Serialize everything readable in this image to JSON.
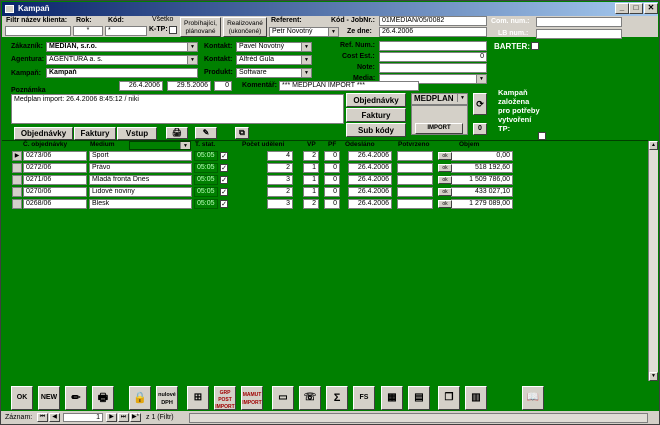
{
  "window": {
    "title": "Kampaň",
    "min": "_",
    "max": "□",
    "close": "✕"
  },
  "header": {
    "filter_label": "Filtr název klienta:",
    "rok_label": "Rok:",
    "kod_label": "Kód:",
    "filter_value": "",
    "rok_value": "*",
    "kod_value": "*",
    "vsetko_label": "Všetko",
    "ktp_label": "K-TP:",
    "btn_probihajici": "Probíhající, plánované",
    "btn_realizovane": "Realizované (ukončené)",
    "referent_label": "Referent:",
    "referent_value": "Petr Novotný",
    "kod_jobn_label": "Kód - JobNr.:",
    "kod_jobn_value": "01MEDIAN/05/0082",
    "ze_dne_label": "Ze dne:",
    "ze_dne_value": "26.4.2006",
    "com_num_label": "Com. num.:",
    "lb_num_label": "LB num.:",
    "barter_label": "BARTER:"
  },
  "form": {
    "zakaznik_label": "Zákazník:",
    "zakaznik_value": "MEDIAN, s.r.o.",
    "agentura_label": "Agentura:",
    "agentura_value": "AGENTURA a. s.",
    "kampan_label": "Kampaň:",
    "kampan_value": "Kampaň",
    "kontakt1_label": "Kontakt:",
    "kontakt1_value": "Pavel Novotný",
    "kontakt2_label": "Kontakt:",
    "kontakt2_value": "Alfréd Gula",
    "produkt_label": "Produkt:",
    "produkt_value": "Software",
    "ref_num_label": "Ref. Num.:",
    "cost_est_label": "Cost Est.:",
    "cost_est_value": "0",
    "note_label": "Note:",
    "media_label": "Media:",
    "date_from": "26.4.2006",
    "date_to": "29.5.2006",
    "count": "0",
    "komentar_label": "Komentář:",
    "komentar_value": "*** MEDPLAN IMPORT ***",
    "poznamka_label": "Poznámka",
    "poznamka_value": "Medplan import: 26.4.2006 8:45:12 / niki",
    "btn_objednavky": "Objednávky",
    "btn_faktury": "Faktury",
    "btn_subkody": "Sub kódy",
    "medplan_value": "MEDPLAN",
    "btn_import": "IMPORT",
    "zero_value": "0",
    "campaign_note": "Kampaň založena pro potřeby vytvoření TP:"
  },
  "tabs": [
    "Objednávky",
    "Faktury",
    "Vstup"
  ],
  "grid": {
    "headers": {
      "cislo": "Č. objednávky",
      "medium": "Medium",
      "stat": "T. stat.",
      "pocet": "Počet uděleni",
      "vp": "VP",
      "pf": "PF",
      "odeslano": "Odesláno",
      "potvrzeno": "Potvrzeno",
      "objem": "Objem"
    },
    "rows": [
      {
        "cislo": "0273/06",
        "medium": "Sport",
        "stat": "05:05",
        "pocet": "4",
        "vp": "2",
        "pf": "0",
        "odeslano": "26.4.2006",
        "objem": "0,00"
      },
      {
        "cislo": "0272/06",
        "medium": "Právo",
        "stat": "05:05",
        "pocet": "2",
        "vp": "1",
        "pf": "0",
        "odeslano": "26.4.2006",
        "objem": "518 192,60"
      },
      {
        "cislo": "0271/06",
        "medium": "Mladá fronta Dnes",
        "stat": "05:05",
        "pocet": "3",
        "vp": "1",
        "pf": "0",
        "odeslano": "26.4.2006",
        "objem": "1 509 786,00"
      },
      {
        "cislo": "0270/06",
        "medium": "Lidové noviny",
        "stat": "05:05",
        "pocet": "2",
        "vp": "1",
        "pf": "0",
        "odeslano": "26.4.2006",
        "objem": "433 027,10"
      },
      {
        "cislo": "0268/06",
        "medium": "Blesk",
        "stat": "05:05",
        "pocet": "3",
        "vp": "2",
        "pf": "0",
        "odeslano": "26.4.2006",
        "objem": "1 279 089,00"
      }
    ],
    "ok_label": "ok"
  },
  "toolbar": {
    "ok": "OK",
    "new": "NEW",
    "nulove_dph": "nulové DPH",
    "grp_post": "GRP POST IMPORT",
    "mamut": "MAMUT IMPORT",
    "sigma": "Σ",
    "fs": "FS"
  },
  "status": {
    "zaznam_label": "Záznam:",
    "current": "1",
    "total_text": "z 1 (Filtr)"
  }
}
